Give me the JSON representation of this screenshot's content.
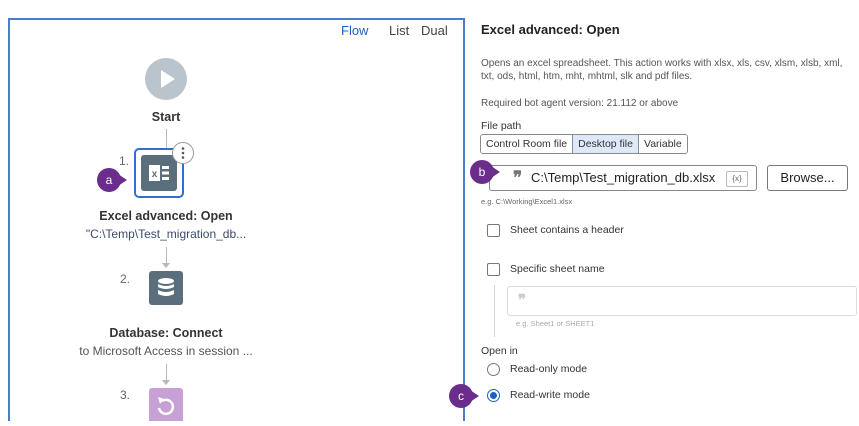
{
  "flow_view": {
    "tabs": [
      {
        "label": "Flow",
        "active": true
      },
      {
        "label": "List",
        "active": false
      },
      {
        "label": "Dual",
        "active": false
      }
    ],
    "nodes": [
      {
        "number": "",
        "title": "Start",
        "subtitle": ""
      },
      {
        "number": "1.",
        "title": "Excel advanced: Open",
        "subtitle": "\"C:\\Temp\\Test_migration_db..."
      },
      {
        "number": "2.",
        "title": "Database: Connect",
        "subtitle": "to Microsoft Access in session ..."
      },
      {
        "number": "3.",
        "title": "",
        "subtitle": ""
      }
    ]
  },
  "callouts": {
    "a": "a",
    "b": "b",
    "c": "c"
  },
  "details": {
    "title": "Excel advanced: Open",
    "description": "Opens an excel spreadsheet. This action works with xlsx, xls, csv, xlsm, xlsb, xml, txt, ods, html, htm, mht, mhtml, slk and pdf files.",
    "required_version": "Required bot agent version: 21.112 or above",
    "file_path": {
      "label": "File path",
      "tabs": [
        {
          "label": "Control Room file",
          "active": false
        },
        {
          "label": "Desktop file",
          "active": true
        },
        {
          "label": "Variable",
          "active": false
        }
      ],
      "value": "C:\\Temp\\Test_migration_db.xlsx",
      "variable_token": "{x}",
      "hint": "e.g. C:\\Working\\Excel1.xlsx",
      "browse_label": "Browse..."
    },
    "sheet_header_label": "Sheet contains a header",
    "specific_sheet_label": "Specific sheet name",
    "sheet_hint": "e.g. Sheet1 or SHEET1",
    "open_in": {
      "label": "Open in",
      "options": [
        {
          "label": "Read-only mode",
          "checked": false
        },
        {
          "label": "Read-write mode",
          "checked": true
        }
      ]
    }
  },
  "colors": {
    "accent": "#1f5fbf",
    "callout": "#6b2d8c",
    "excel_icon": "#5a6e7c",
    "start_icon": "#b9c4cc",
    "loop_icon": "#c7a0d6"
  }
}
